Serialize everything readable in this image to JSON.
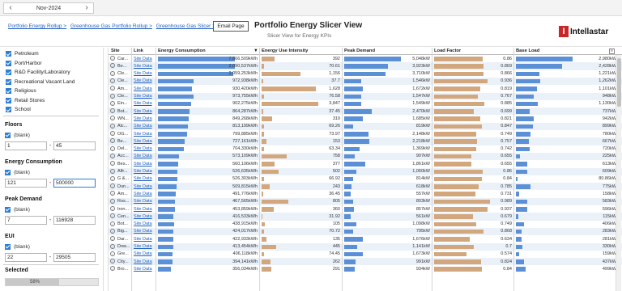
{
  "topbar": {
    "prev_label": "‹",
    "month": "Nov-2024",
    "next_label": "›"
  },
  "header": {
    "breadcrumbs": [
      "Portfolio Energy Rollup >",
      "Greenhouse Gas Portfolio Rollup >",
      "Greenhouse Gas Slicer >"
    ],
    "email_button": "Email Page",
    "title": "Portfolio Energy Slicer View",
    "subtitle": "Slicer View for Energy KPIs",
    "logo_text": "Intellastar"
  },
  "sidebar": {
    "categories": [
      "Petroleum",
      "Port/Harbor",
      "R&D Facility/Laboratory",
      "Recreational Vacant Land",
      "Religious",
      "Retail Stores",
      "School"
    ],
    "filters": [
      {
        "label": "Floors",
        "blank": "(blank)",
        "min": "1",
        "max": "45"
      },
      {
        "label": "Energy Consumption",
        "blank": "(blank)",
        "min": "121",
        "max": "500000"
      },
      {
        "label": "Peak Demand",
        "blank": "(blank)",
        "min": "7",
        "max": "116928"
      },
      {
        "label": "EUI",
        "blank": "(blank)",
        "min": "22",
        "max": "29505"
      }
    ],
    "selected_label": "Selected",
    "progress_text": "58%",
    "progress_value": 0.58
  },
  "table": {
    "columns": [
      "Site",
      "Link",
      "Energy Consumption",
      "Energy Use Intensity",
      "Peak Demand",
      "Load Factor",
      "Base Load"
    ],
    "sort_indicator": "▼",
    "menu_icon": "≡",
    "link_text": "Site Data",
    "colors": {
      "energy": "#5b8fd6",
      "eui": "#d2a77e",
      "peak": "#5b8fd6",
      "load": "#d2a77e",
      "base": "#5b8fd6",
      "row_alt": "#eaf1f9"
    },
    "rows": [
      [
        "Car...",
        "7,666,509kWh",
        "392",
        "5,048kW",
        "0.86",
        "2,980kW"
      ],
      [
        "Be...",
        "2,090,537kWh",
        "70.61",
        "3,923kW",
        "0.869",
        "2,428kW"
      ],
      [
        "Cle...",
        "2,059,253kWh",
        "1,156",
        "3,710kW",
        "0.866",
        "1,221kW"
      ],
      [
        "Cle...",
        "972,938kWh",
        "37.7",
        "1,546kW",
        "0.936",
        "1,262kW"
      ],
      [
        "Am...",
        "930,420kWh",
        "1,628",
        "1,672kW",
        "0.819",
        "1,101kW"
      ],
      [
        "Cle...",
        "973,755kWh",
        "76.58",
        "1,547kW",
        "0.767",
        "948kW"
      ],
      [
        "Ein...",
        "902,275kWh",
        "3,847",
        "1,549kW",
        "0.885",
        "1,130kW"
      ],
      [
        "Bot...",
        "864,287kWh",
        "37.45",
        "2,470kW",
        "0.699",
        "737kW"
      ],
      [
        "WN...",
        "849,268kWh",
        "319",
        "1,685kW",
        "0.821",
        "942kW"
      ],
      [
        "Alc...",
        "813,199kWh",
        "69.26",
        "819kW",
        "0.847",
        "899kW"
      ],
      [
        "OG...",
        "799,885kWh",
        "73.97",
        "2,148kW",
        "0.749",
        "780kW"
      ],
      [
        "Be...",
        "727,161kWh",
        "153",
        "2,218kW",
        "0.757",
        "667kW"
      ],
      [
        "Del...",
        "704,330kWh",
        "63.34",
        "1,369kW",
        "0.742",
        "720kW"
      ],
      [
        "Acc...",
        "573,109kWh",
        "758",
        "907kW",
        "0.655",
        "225kW"
      ],
      [
        "Bes...",
        "560,106kWh",
        "377",
        "1,861kW",
        "0.655",
        "613kW"
      ],
      [
        "Alfr...",
        "526,635kWh",
        "502",
        "1,060kW",
        "0.86",
        "609kW"
      ],
      [
        "G &...",
        "526,303kWh",
        "66.92",
        "814kW",
        "0.84",
        "80.86kW"
      ],
      [
        "Dun...",
        "509,815kWh",
        "243",
        "618kW",
        "0.785",
        "775kW"
      ],
      [
        "Am...",
        "491,776kWh",
        "36.45",
        "557kW",
        "0.731",
        "158kW"
      ],
      [
        "Ros...",
        "467,565kWh",
        "805",
        "803kW",
        "0.989",
        "583kW"
      ],
      [
        "Iron...",
        "453,859kWh",
        "360",
        "857kW",
        "0.937",
        "596kW"
      ],
      [
        "Cen...",
        "416,533kWh",
        "31.92",
        "561kW",
        "0.679",
        "115kW"
      ],
      [
        "Bot...",
        "438,915kWh",
        "105",
        "1,098kW",
        "0.749",
        "406kW"
      ],
      [
        "Big...",
        "424,017kWh",
        "70.72",
        "795kW",
        "0.868",
        "283kW"
      ],
      [
        "Dar...",
        "422,933kWh",
        "135",
        "1,676kW",
        "0.634",
        "281kW"
      ],
      [
        "Dow...",
        "413,454kWh",
        "445",
        "1,141kW",
        "0.7",
        "330kW"
      ],
      [
        "Gre...",
        "406,118kWh",
        "74.45",
        "1,673kW",
        "0.574",
        "159kW"
      ],
      [
        "City...",
        "394,141kWh",
        "262",
        "991kW",
        "0.824",
        "437kW"
      ],
      [
        "Bro...",
        "356,034kWh",
        "291",
        "934kW",
        "0.84",
        "499kW"
      ]
    ]
  }
}
